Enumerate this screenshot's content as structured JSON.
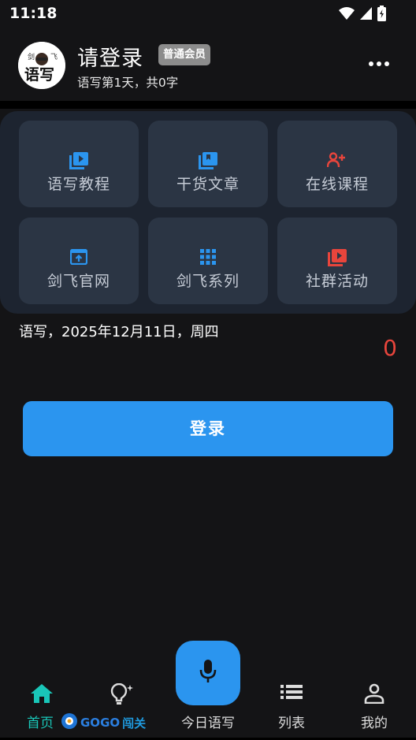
{
  "status_bar": {
    "time": "11:18"
  },
  "header": {
    "avatar_text_top_left": "剑",
    "avatar_text_top_right": "飞",
    "avatar_text_main": "语写",
    "user_name": "请登录",
    "member_badge": "普通会员",
    "user_stats": "语写第1天，共0字"
  },
  "grid": {
    "items": [
      {
        "label": "语写教程",
        "icon": "video-library-icon",
        "color": "#2b95ef"
      },
      {
        "label": "干货文章",
        "icon": "book-library-icon",
        "color": "#2b95ef"
      },
      {
        "label": "在线课程",
        "icon": "person-add-icon",
        "color": "#e8453c"
      },
      {
        "label": "剑飞官网",
        "icon": "web-upload-icon",
        "color": "#2b95ef"
      },
      {
        "label": "剑飞系列",
        "icon": "grid-apps-icon",
        "color": "#2b95ef"
      },
      {
        "label": "社群活动",
        "icon": "video-collection-icon",
        "color": "#e8453c"
      }
    ]
  },
  "today": {
    "date_line": "语写，2025年12月11日，周四",
    "word_count": "0"
  },
  "login_button": "登录",
  "bottom_nav": {
    "items": [
      {
        "label": "首页",
        "icon": "home-icon",
        "active": true
      },
      {
        "label": "",
        "icon": "lightbulb-icon",
        "active": false
      },
      {
        "label": "今日语写",
        "icon": "microphone-icon",
        "active": false
      },
      {
        "label": "列表",
        "icon": "list-icon",
        "active": false
      },
      {
        "label": "我的",
        "icon": "person-icon",
        "active": false
      }
    ]
  },
  "watermark": {
    "text": "GOGO",
    "text2": "闯关"
  },
  "colors": {
    "accent": "#2b95ef",
    "active_tab": "#19c6b8",
    "danger": "#e8453c"
  }
}
